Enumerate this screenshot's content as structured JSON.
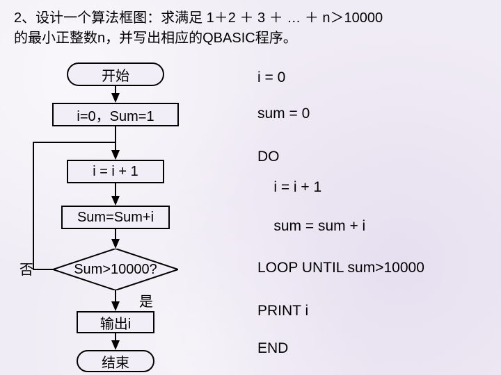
{
  "prompt": {
    "line1": "2、设计一个算法框图：求满足 1＋2 ＋ 3 ＋ … ＋ n＞10000",
    "line2": "的最小正整数n，并写出相应的QBASIC程序。"
  },
  "flow": {
    "start": "开始",
    "init": "i=0，Sum=1",
    "step": "i = i + 1",
    "accum": "Sum=Sum+i",
    "cond": "Sum>10000?",
    "no": "否",
    "yes": "是",
    "out": "输出i",
    "end": "结束"
  },
  "code": {
    "l1": "i = 0",
    "l2": "sum = 0",
    "l3": "DO",
    "l4": "    i = i + 1",
    "l5": "    sum = sum + i",
    "l6": "LOOP UNTIL sum>10000",
    "l7": "PRINT i",
    "l8": "END"
  }
}
